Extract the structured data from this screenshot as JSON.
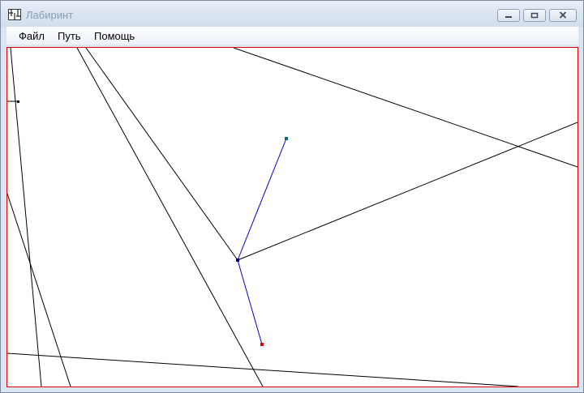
{
  "window": {
    "title": "Лабиринт",
    "icon": "maze-app-icon"
  },
  "menu": {
    "items": [
      {
        "label": "Файл"
      },
      {
        "label": "Путь"
      },
      {
        "label": "Помощь"
      }
    ]
  },
  "colors": {
    "wall": "#000000",
    "path": "#0000c8",
    "start_point": "#006b6b",
    "end_point": "#e00000",
    "canvas_border": "#e00000"
  }
}
